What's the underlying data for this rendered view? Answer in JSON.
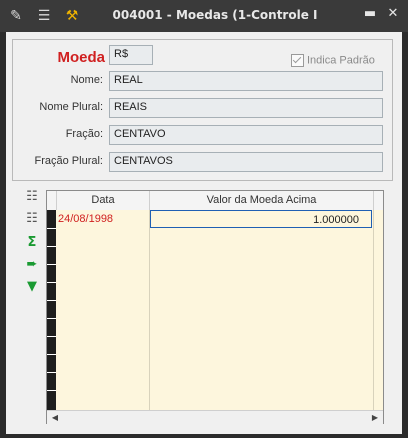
{
  "window": {
    "title": "004001 - Moedas (1-Controle I",
    "icons": [
      "edit-icon",
      "traffic-light-icon",
      "wrench-icon"
    ],
    "controls": [
      "minimize-icon",
      "close-icon"
    ]
  },
  "form": {
    "moeda_label": "Moeda",
    "moeda_value": "R$",
    "indica_padrao_label": "Indica Padrão",
    "indica_padrao_checked": true,
    "fields": [
      {
        "label": "Nome:",
        "value": "REAL"
      },
      {
        "label": "Nome Plural:",
        "value": "REAIS"
      },
      {
        "label": "Fração:",
        "value": "CENTAVO"
      },
      {
        "label": "Fração Plural:",
        "value": "CENTAVOS"
      }
    ]
  },
  "toolbar": {
    "tools": [
      "add-row-icon",
      "remove-row-icon",
      "sum-icon",
      "export-icon",
      "collapse-icon"
    ]
  },
  "grid": {
    "columns": [
      "Data",
      "Valor da Moeda Acima"
    ],
    "rows": [
      {
        "data": "24/08/1998",
        "valor": "1.000000"
      }
    ],
    "colors": {
      "row_bg": "#fdf6dd",
      "date_text": "#d02020",
      "selection_border": "#1f5fb3"
    }
  }
}
